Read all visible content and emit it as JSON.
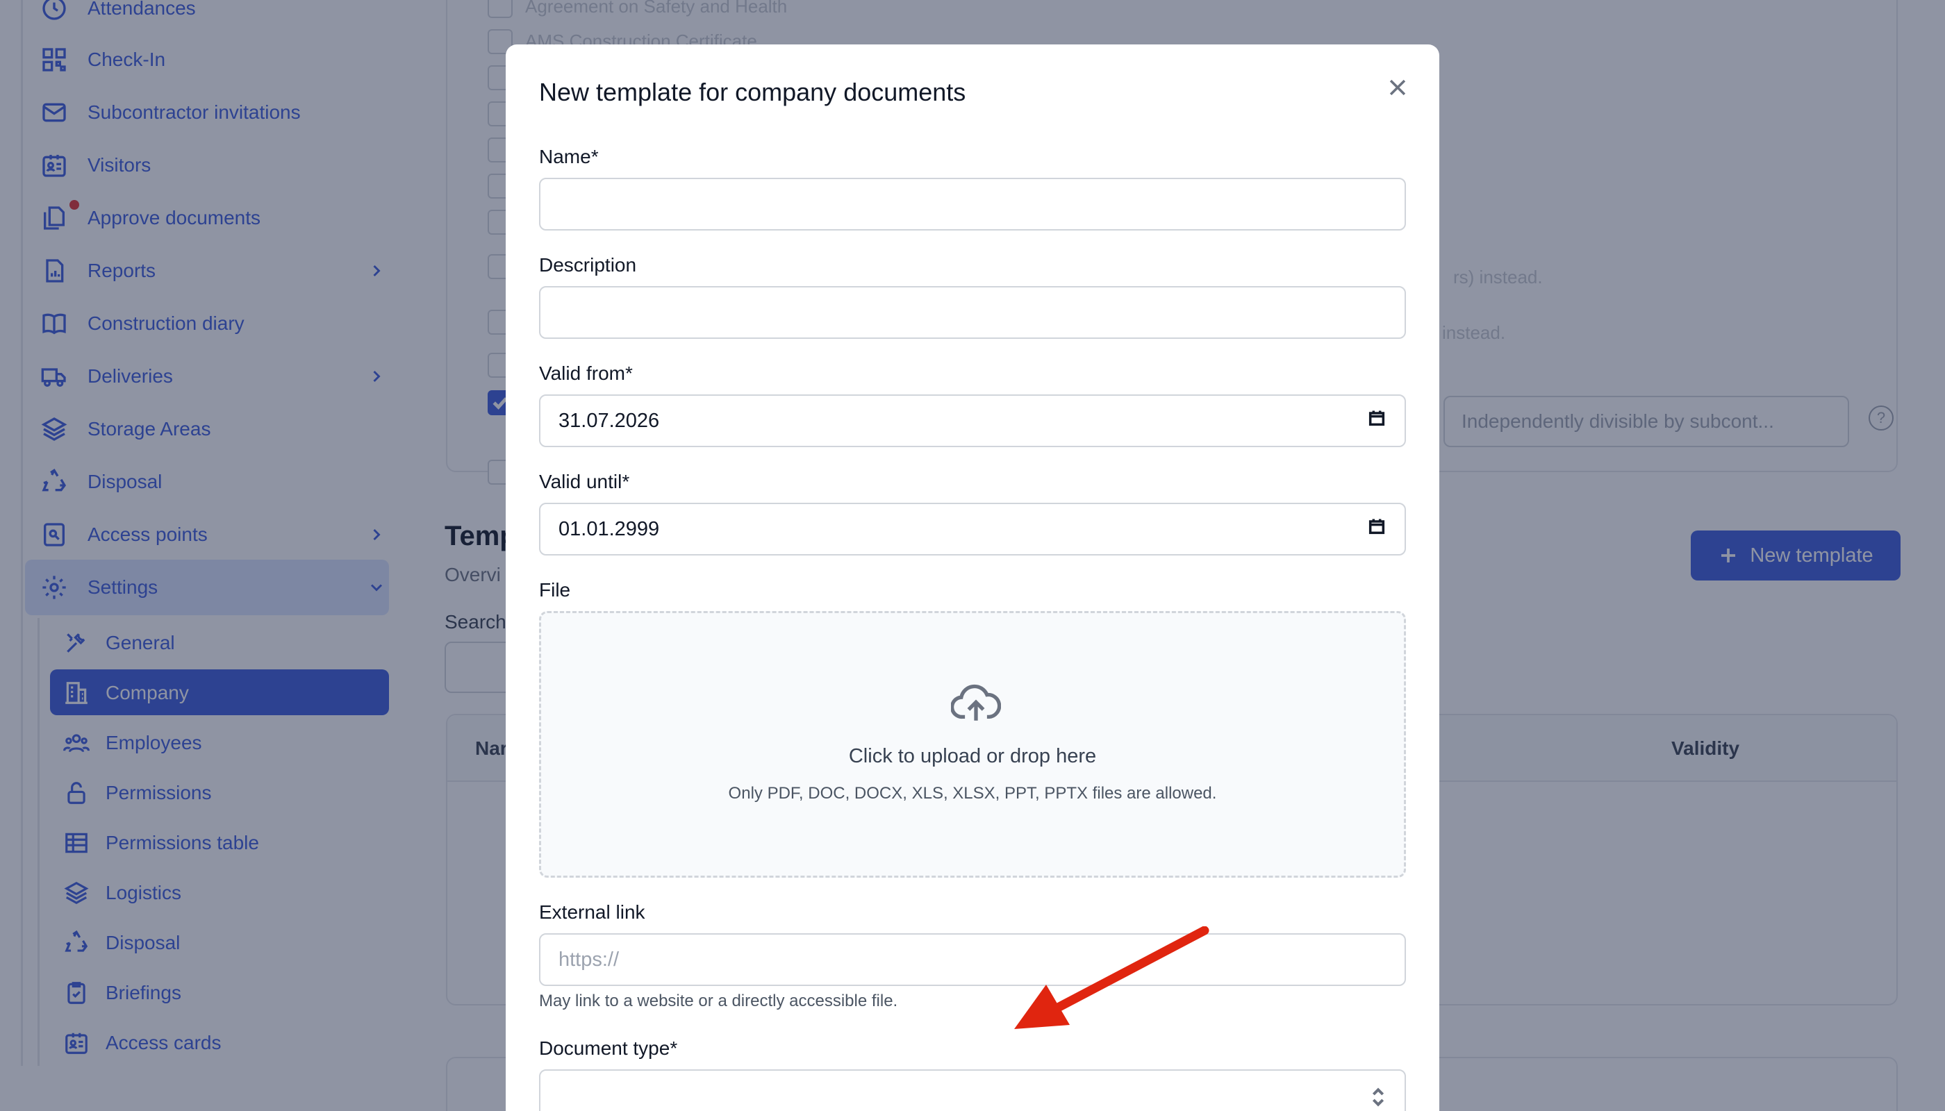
{
  "sidebar": {
    "items": [
      {
        "label": "Attendances",
        "icon": "clock-icon"
      },
      {
        "label": "Check-In",
        "icon": "qr-code-icon"
      },
      {
        "label": "Subcontractor invitations",
        "icon": "envelope-icon"
      },
      {
        "label": "Visitors",
        "icon": "id-badge-icon"
      },
      {
        "label": "Approve documents",
        "icon": "documents-icon"
      },
      {
        "label": "Reports",
        "icon": "report-icon"
      },
      {
        "label": "Construction diary",
        "icon": "book-icon"
      },
      {
        "label": "Deliveries",
        "icon": "truck-icon"
      },
      {
        "label": "Storage Areas",
        "icon": "layers-icon"
      },
      {
        "label": "Disposal",
        "icon": "recycle-icon"
      },
      {
        "label": "Access points",
        "icon": "key-icon"
      },
      {
        "label": "Settings",
        "icon": "gear-icon"
      }
    ],
    "settings_items": [
      {
        "label": "General",
        "icon": "tools-icon"
      },
      {
        "label": "Company",
        "icon": "building-icon"
      },
      {
        "label": "Employees",
        "icon": "users-icon"
      },
      {
        "label": "Permissions",
        "icon": "lock-icon"
      },
      {
        "label": "Permissions table",
        "icon": "table-icon"
      },
      {
        "label": "Logistics",
        "icon": "layers-icon"
      },
      {
        "label": "Disposal",
        "icon": "recycle-icon"
      },
      {
        "label": "Briefings",
        "icon": "clipboard-icon"
      },
      {
        "label": "Access cards",
        "icon": "id-card-icon"
      }
    ]
  },
  "background": {
    "doc_list": [
      "Agreement on Safety and Health",
      "AMS Construction Certificate"
    ],
    "note_1": "rs) instead.",
    "note_2": "instead.",
    "division_select": "Independently divisible by subcont...",
    "section_title": "Temp",
    "section_subtitle": "Overvi",
    "search_label": "Search",
    "new_template_label": "New template",
    "table_col_name": "Nar",
    "table_col_validity": "Validity"
  },
  "modal": {
    "title": "New template for company documents",
    "name_label": "Name*",
    "name_value": "",
    "description_label": "Description",
    "description_value": "",
    "valid_from_label": "Valid from*",
    "valid_from_value": "31.07.2026",
    "valid_until_label": "Valid until*",
    "valid_until_value": "01.01.2999",
    "file_label": "File",
    "upload_title": "Click to upload or drop here",
    "upload_hint": "Only PDF, DOC, DOCX, XLS, XLSX, PPT, PPTX files are allowed.",
    "external_link_label": "External link",
    "external_link_placeholder": "https://",
    "external_link_hint": "May link to a website or a directly accessible file.",
    "document_type_label": "Document type*"
  },
  "colors": {
    "accent": "#3b5bdb",
    "annotation_arrow": "#e0250f"
  }
}
